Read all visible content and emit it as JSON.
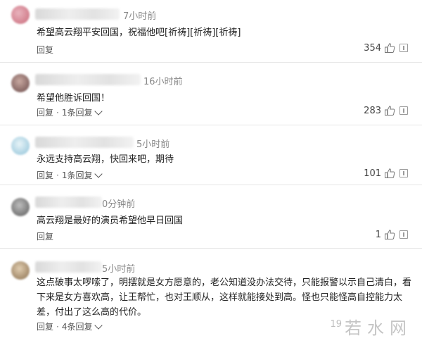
{
  "comments": [
    {
      "time": "7小时前",
      "text": "希望高云翔平安回国，祝福他吧[祈祷][祈祷][祈祷]",
      "reply_label": "回复",
      "reply_count": "",
      "likes": "354",
      "avatar_color": "#c96a7a"
    },
    {
      "time": "16小时前",
      "text": "希望他胜诉回国！",
      "reply_label": "回复",
      "reply_count": "1条回复",
      "likes": "283",
      "avatar_color": "#7a5a5a"
    },
    {
      "time": "5小时前",
      "text": "永远支持高云翔，快回来吧，期待",
      "reply_label": "回复",
      "reply_count": "1条回复",
      "likes": "101",
      "avatar_color": "#8fc2d8"
    },
    {
      "time": "0分钟前",
      "text": "高云翔是最好的演员希望他早日回国",
      "reply_label": "回复",
      "reply_count": "",
      "likes": "1",
      "avatar_color": "#6b6b6b"
    },
    {
      "time": "5小时前",
      "text": "这点破事太啰嗦了，明摆就是女方愿意的，老公知道没办法交待，只能报警以示自己清白，看下来是女方喜欢高，让王帮忙，也对王顺从，这样就能接处到高。怪也只能怪高自控能力太差，付出了这么高的代价。",
      "reply_label": "回复",
      "reply_count": "4条回复",
      "likes": "19",
      "avatar_color": "#a08a6a"
    }
  ],
  "separator": "·",
  "watermark": "若水网"
}
